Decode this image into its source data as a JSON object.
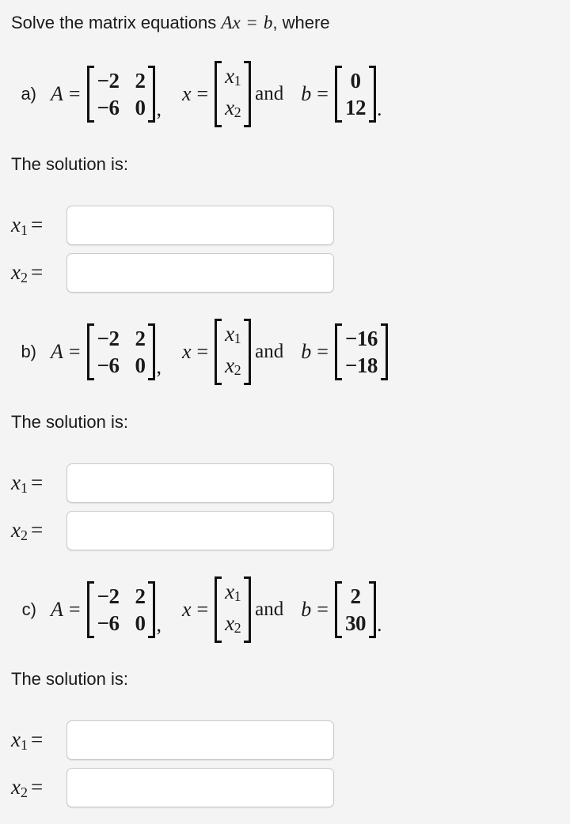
{
  "prompt": {
    "lead": "Solve the matrix equations",
    "equation_A": "A",
    "equation_x": "x",
    "equation_rel": "=",
    "equation_b": "b",
    "trail": ", where"
  },
  "symbols": {
    "A": "A",
    "x": "x",
    "b": "b",
    "equals": "=",
    "and": "and",
    "comma": ",",
    "period": ".",
    "x1": "x",
    "x2": "x",
    "sub1": "1",
    "sub2": "2"
  },
  "matrix_A": {
    "rows": [
      [
        "−2",
        "2"
      ],
      [
        "−6",
        "0"
      ]
    ]
  },
  "vector_x": {
    "rows": [
      "x1",
      "x2"
    ]
  },
  "solution_label": "The solution is:",
  "parts": [
    {
      "label": "a)",
      "A": {
        "rows": [
          [
            "−2",
            "2"
          ],
          [
            "−6",
            "0"
          ]
        ]
      },
      "b": {
        "rows": [
          "0",
          "12"
        ]
      },
      "trailing_punct": ".",
      "solution_label": "The solution is:",
      "answers": [
        {
          "label_var": "x",
          "label_sub": "1",
          "label_eq": "=",
          "value": "",
          "placeholder": ""
        },
        {
          "label_var": "x",
          "label_sub": "2",
          "label_eq": "=",
          "value": "",
          "placeholder": ""
        }
      ]
    },
    {
      "label": "b)",
      "A": {
        "rows": [
          [
            "−2",
            "2"
          ],
          [
            "−6",
            "0"
          ]
        ]
      },
      "b": {
        "rows": [
          "−16",
          "−18"
        ]
      },
      "trailing_punct": "",
      "solution_label": "The solution is:",
      "answers": [
        {
          "label_var": "x",
          "label_sub": "1",
          "label_eq": "=",
          "value": "",
          "placeholder": ""
        },
        {
          "label_var": "x",
          "label_sub": "2",
          "label_eq": "=",
          "value": "",
          "placeholder": ""
        }
      ]
    },
    {
      "label": "c)",
      "A": {
        "rows": [
          [
            "−2",
            "2"
          ],
          [
            "−6",
            "0"
          ]
        ]
      },
      "b": {
        "rows": [
          "2",
          "30"
        ]
      },
      "trailing_punct": ".",
      "solution_label": "The solution is:",
      "answers": [
        {
          "label_var": "x",
          "label_sub": "1",
          "label_eq": "=",
          "value": "",
          "placeholder": ""
        },
        {
          "label_var": "x",
          "label_sub": "2",
          "label_eq": "=",
          "value": "",
          "placeholder": ""
        }
      ]
    }
  ],
  "colors": {
    "background": "#f4f4f4",
    "text": "#1a1a1a",
    "input_border": "#c9c9c9",
    "input_background": "#ffffff"
  }
}
